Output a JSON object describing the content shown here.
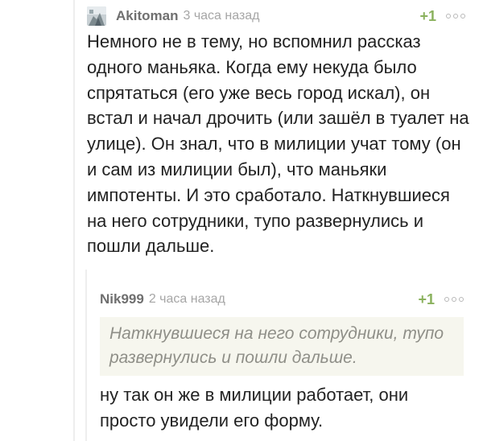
{
  "comments": [
    {
      "author": "Akitoman",
      "time": "3 часа назад",
      "rating": "+1",
      "text": "Немного не в тему, но вспомнил рассказ одного маньяка. Когда ему некуда было спрятаться (его уже весь город искал), он встал и начал дрочить (или зашёл в туалет на улице). Он знал, что в милиции учат тому (он и сам из милиции был), что маньяки импотенты. И это сработало. Наткнувшиеся на него сотрудники, тупо развернулись и пошли дальше."
    },
    {
      "author": "Nik999",
      "time": "2 часа назад",
      "rating": "+1",
      "quote": "Наткнувшиеся на него сотрудники, тупо развернулись и пошли дальше.",
      "text": "ну так он же в милиции работает, они просто увидели его форму."
    }
  ],
  "colors": {
    "rating": "#8ab15d",
    "author": "#6f6f6f",
    "time": "#a6a6a6",
    "quote_bg": "#f6f6ee",
    "thread_line": "#eeeeee"
  },
  "icons": {
    "avatar": "avatar",
    "more": "more-options-icon"
  }
}
